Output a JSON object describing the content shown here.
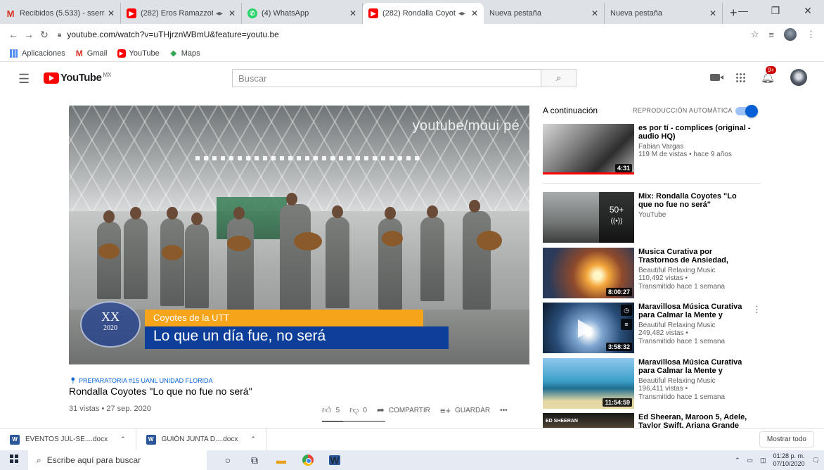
{
  "browser": {
    "tabs": [
      {
        "title": "Recibidos (5.533) - sserrano",
        "favicon": "gmail-icon",
        "audio": false,
        "active": false
      },
      {
        "title": "(282) Eros Ramazzotti, Al",
        "favicon": "youtube-icon",
        "audio": true,
        "active": false
      },
      {
        "title": "(4) WhatsApp",
        "favicon": "whatsapp-icon",
        "audio": false,
        "active": false
      },
      {
        "title": "(282) Rondalla Coyotes",
        "favicon": "youtube-icon",
        "audio": true,
        "active": true
      },
      {
        "title": "Nueva pestaña",
        "favicon": "",
        "audio": false,
        "active": false
      },
      {
        "title": "Nueva pestaña",
        "favicon": "",
        "audio": false,
        "active": false
      }
    ],
    "new_tab_glyph": "+",
    "url": "youtube.com/watch?v=uTHjrznWBmU&feature=youtu.be",
    "bookmarks": [
      {
        "label": "Aplicaciones",
        "icon": "apps-grid-icon"
      },
      {
        "label": "Gmail",
        "icon": "gmail-icon"
      },
      {
        "label": "YouTube",
        "icon": "youtube-icon"
      },
      {
        "label": "Maps",
        "icon": "maps-icon"
      }
    ]
  },
  "youtube": {
    "logo_text": "YouTube",
    "country_code": "MX",
    "search_placeholder": "Buscar",
    "notification_count": "9+"
  },
  "video": {
    "overlay_watermark": "youtube/moui pé",
    "lower_third_roman": "XX",
    "lower_third_year": "2020",
    "lower_third_label": "Coyotes de la UTT",
    "lower_third_caption": "Lo que un día fue, no será",
    "location": "PREPARATORIA #15 UANL UNIDAD FLORIDA",
    "title": "Rondalla Coyotes \"Lo que no fue no será\"",
    "views_date": "31 vistas • 27 sep. 2020",
    "likes": "5",
    "dislikes": "0",
    "share_label": "COMPARTIR",
    "save_label": "GUARDAR",
    "more_glyph": "•••"
  },
  "sidebar": {
    "up_next_label": "A continuación",
    "autoplay_label": "REPRODUCCIÓN AUTOMÁTICA",
    "autoplay_on": true,
    "items": [
      {
        "title": "es por tí - complices (original - audio HQ)",
        "channel": "Fabian Vargas",
        "meta1": "119 M de vistas • hace 9 años",
        "meta2": "",
        "duration": "4:31"
      },
      {
        "title": "Mix: Rondalla Coyotes \"Lo que no fue no será\"",
        "channel": "YouTube",
        "meta1": "",
        "meta2": "",
        "duration": "",
        "mix_count": "50+"
      },
      {
        "title": "Musica Curativa por Trastornos de Ansiedad, Miedos, Depresi...",
        "channel": "Beautiful Relaxing Music",
        "meta1": "110,492 vistas •",
        "meta2": "Transmitido hace 1 semana",
        "duration": "8:00:27"
      },
      {
        "title": "Maravillosa Música Curativa para Calmar la Mente y Aliviar...",
        "channel": "Beautiful Relaxing Music",
        "meta1": "249,482 vistas •",
        "meta2": "Transmitido hace 1 semana",
        "duration": "3:58:32"
      },
      {
        "title": "Maravillosa Música Curativa para Calmar la Mente y Aliviar...",
        "channel": "Beautiful Relaxing Music",
        "meta1": "196,411 vistas •",
        "meta2": "Transmitido hace 1 semana",
        "duration": "11:54:59"
      },
      {
        "title": "Ed Sheeran, Maroon 5, Adele, Taylor Swift, Ariana Grande",
        "channel": "",
        "meta1": "",
        "meta2": "",
        "duration": "",
        "thumb_text": "ED SHEERAN"
      }
    ]
  },
  "downloads": {
    "items": [
      {
        "name": "EVENTOS JUL-SE....docx"
      },
      {
        "name": "GUIÓN JUNTA D....docx"
      }
    ],
    "show_all": "Mostrar todo"
  },
  "taskbar": {
    "search_placeholder": "Escribe aquí para buscar",
    "time": "01:28 p. m.",
    "date": "07/10/2020"
  }
}
